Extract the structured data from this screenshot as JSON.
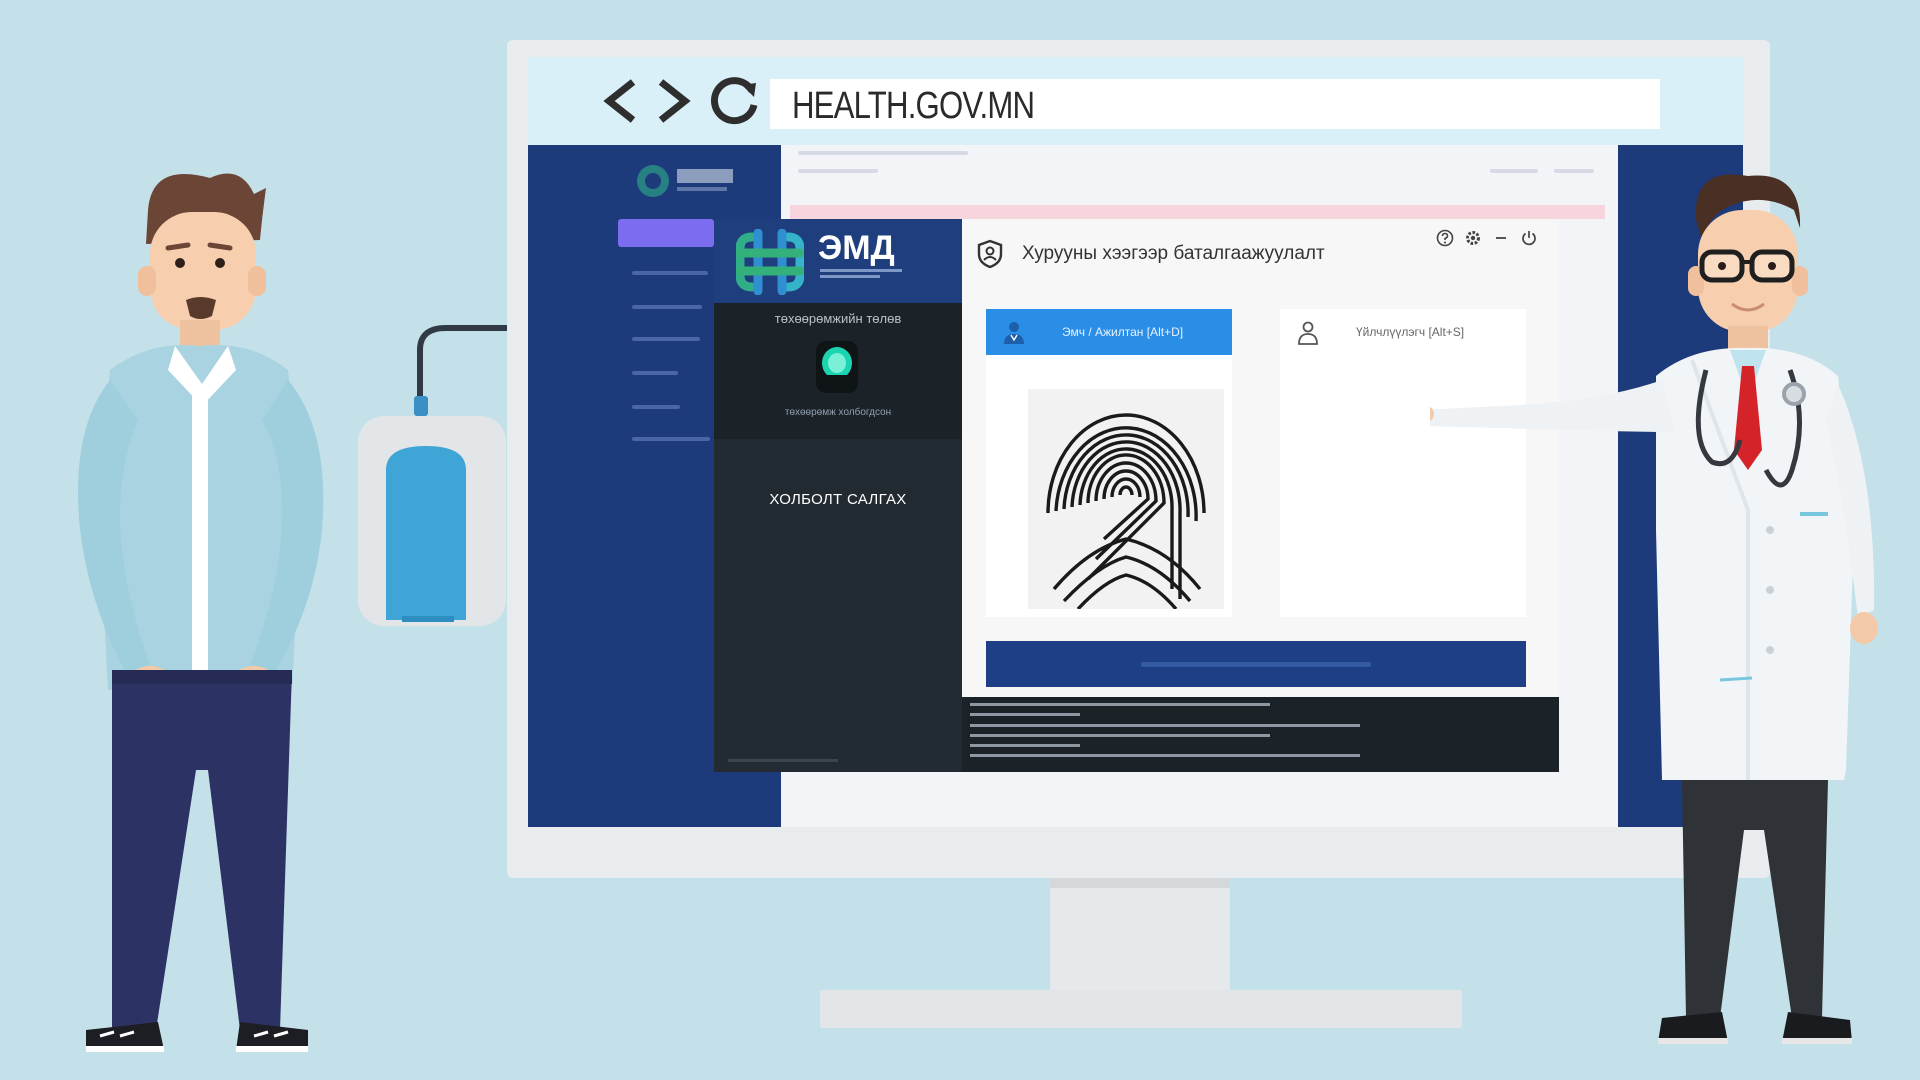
{
  "browser": {
    "url": "HEALTH.GOV.MN",
    "icons": [
      "back-icon",
      "forward-icon",
      "reload-icon"
    ]
  },
  "dialog": {
    "logo_text": "ЭМД",
    "title": "Хурууны хээгээр баталгаажуулалт",
    "controls": [
      "help-icon",
      "settings-icon",
      "minimize-icon",
      "power-icon"
    ],
    "device": {
      "label": "төхөөрөмжийн төлөв",
      "status": "төхөөрөмж холбогдсон"
    },
    "disconnect_label": "ХОЛБОЛТ САЛГАХ",
    "tabs": [
      {
        "label": "Эмч / Ажилтан [Alt+D]",
        "icon": "doctor-icon",
        "active": true
      },
      {
        "label": "Үйлчлүүлэгч [Alt+S]",
        "icon": "patient-icon",
        "active": false
      }
    ]
  },
  "colors": {
    "background": "#c4e1e9",
    "site_navy": "#1d3b7a",
    "accent_blue": "#2a8ee6",
    "dialog_dark": "#232b32",
    "button_navy": "#1e3f86"
  }
}
